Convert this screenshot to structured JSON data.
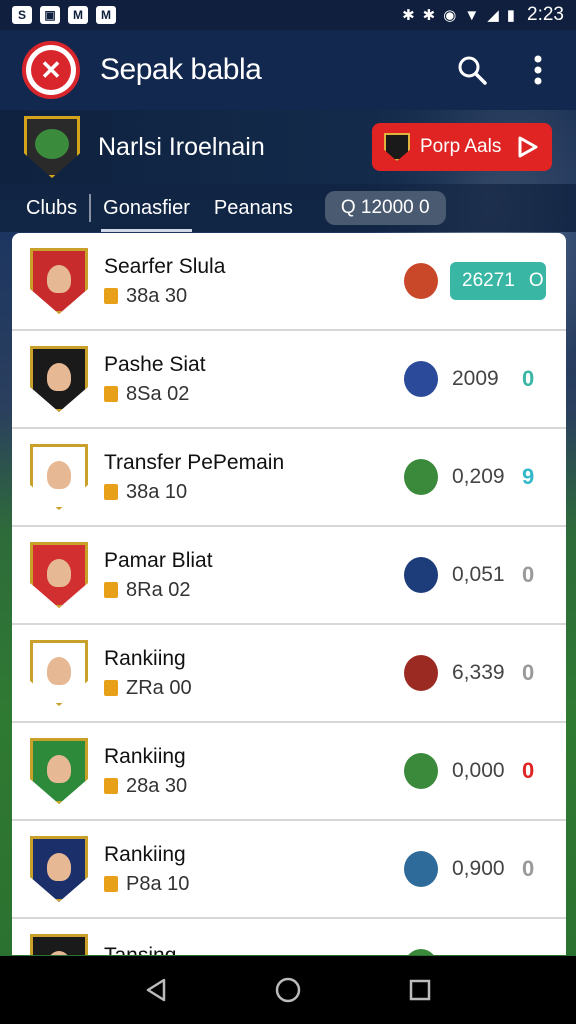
{
  "status_bar": {
    "time": "2:23",
    "left_icons": [
      "S",
      "▣",
      "M",
      "M"
    ]
  },
  "app": {
    "title": "Sepak babla",
    "logo": "✕"
  },
  "banner": {
    "title": "Narlsi Iroelnain",
    "promo_label": "Porp Aals"
  },
  "tabs": [
    {
      "label": "Clubs"
    },
    {
      "label": "Gonasfier"
    },
    {
      "label": "Peanans"
    }
  ],
  "search_chip": {
    "label": "Q 12000 0"
  },
  "rows": [
    {
      "name": "Searfer Slula",
      "sub": "38a 30",
      "value": "26271",
      "icon": "O",
      "crest_color": "#c82b2b",
      "mini_color": "#c9482a",
      "icon_color": "#3ab7a4",
      "pill": true
    },
    {
      "name": "Pashe Siat",
      "sub": "8Sa 02",
      "value": "2009",
      "icon": "0",
      "crest_color": "#1a1a1a",
      "mini_color": "#2c4a9a",
      "icon_color": "#3ab7a4",
      "pill": false
    },
    {
      "name": "Transfer PePemain",
      "sub": "38a 10",
      "value": "0,209",
      "icon": "9",
      "crest_color": "#ffffff",
      "mini_color": "#3b8a3c",
      "icon_color": "#35b8c9",
      "pill": false
    },
    {
      "name": "Pamar Bliat",
      "sub": "8Ra 02",
      "value": "0,051",
      "icon": "0",
      "crest_color": "#d23030",
      "mini_color": "#1d3d7a",
      "icon_color": "#9a9a9a",
      "pill": false
    },
    {
      "name": "Rankiing",
      "sub": "ZRa 00",
      "value": "6,339",
      "icon": "0",
      "crest_color": "#ffffff",
      "mini_color": "#9b2a22",
      "icon_color": "#9a9a9a",
      "pill": false
    },
    {
      "name": "Rankiing",
      "sub": "28a 30",
      "value": "0,000",
      "icon": "0",
      "crest_color": "#2c8a3a",
      "mini_color": "#3b8a3c",
      "icon_color": "#e02424",
      "pill": false
    },
    {
      "name": "Rankiing",
      "sub": "P8a 10",
      "value": "0,900",
      "icon": "0",
      "crest_color": "#1b2f6b",
      "mini_color": "#2e6b9a",
      "icon_color": "#9a9a9a",
      "pill": false
    },
    {
      "name": "Tansing",
      "sub": "",
      "value": "",
      "icon": "",
      "crest_color": "#1a1a1a",
      "mini_color": "#3b8a3c",
      "icon_color": "#9a9a9a",
      "pill": false
    }
  ]
}
